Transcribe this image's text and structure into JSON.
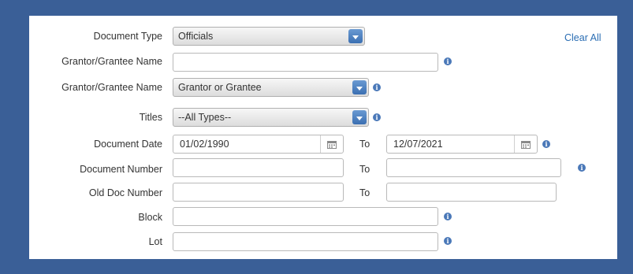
{
  "labels": {
    "document_type": "Document Type",
    "grantor_grantee_name": "Grantor/Grantee Name",
    "grantor_grantee_type": "Grantor/Grantee Name",
    "titles": "Titles",
    "document_date": "Document Date",
    "document_number": "Document Number",
    "old_doc_number": "Old Doc Number",
    "block": "Block",
    "lot": "Lot",
    "to": "To"
  },
  "fields": {
    "document_type": "Officials",
    "grantor_grantee_type": "Grantor or Grantee",
    "titles": "--All Types--",
    "date_from": "01/02/1990",
    "date_to": "12/07/2021",
    "grantor_grantee_name": "",
    "document_number_from": "",
    "document_number_to": "",
    "old_doc_number_from": "",
    "old_doc_number_to": "",
    "block": "",
    "lot": ""
  },
  "actions": {
    "clear_all": "Clear All"
  },
  "icons": {
    "info": "info-icon",
    "calendar": "calendar-icon",
    "dropdown": "chevron-down-icon"
  },
  "colors": {
    "frame": "#3a5f97",
    "accent": "#3b6fb2",
    "link": "#2a6db3"
  }
}
